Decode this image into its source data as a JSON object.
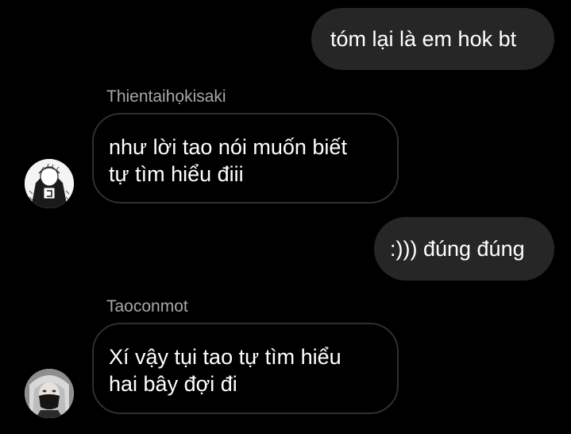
{
  "messages": [
    {
      "direction": "outgoing",
      "text": "tóm lại là em hok bt"
    },
    {
      "direction": "incoming",
      "sender": "Thientaihọkisaki",
      "lines": [
        "như lời tao nói muốn biết",
        "tự tìm hiểu điii"
      ],
      "avatar_icon": "manga-sketch-avatar-icon"
    },
    {
      "direction": "outgoing",
      "text": ":))) đúng đúng"
    },
    {
      "direction": "incoming",
      "sender": "Taoconmot",
      "lines": [
        "Xí vậy tụi tao tự tìm hiểu",
        "hai bây đợi đi"
      ],
      "avatar_icon": "masked-person-avatar-icon"
    }
  ],
  "colors": {
    "background": "#000000",
    "outgoing_bubble": "#262626",
    "incoming_border": "#2f2f2f",
    "sender_name": "#a8a8a8",
    "text": "#ffffff"
  }
}
